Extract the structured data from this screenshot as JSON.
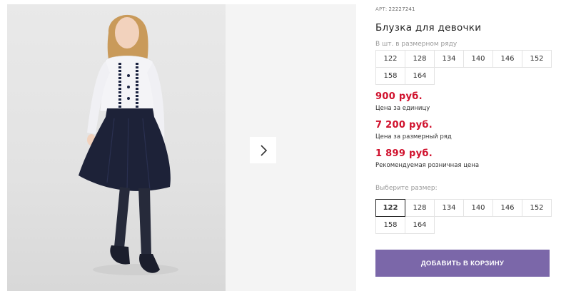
{
  "gallery": {
    "next_icon": "chevron-right-icon"
  },
  "product": {
    "art_label": "АРТ:",
    "art_value": "22227241",
    "title": "Блузка для девочки",
    "size_row_label": "В шт. в размерном ряду",
    "size_row": [
      "122",
      "128",
      "134",
      "140",
      "146",
      "152",
      "158",
      "164"
    ],
    "prices": [
      {
        "value": "900 руб.",
        "note": "Цена за единицу"
      },
      {
        "value": "7 200 руб.",
        "note": "Цена за размерный ряд"
      },
      {
        "value": "1 899 руб.",
        "note": "Рекомендуемая розничная цена"
      }
    ],
    "choose_label": "Выберите размер:",
    "sizes": [
      "122",
      "128",
      "134",
      "140",
      "146",
      "152",
      "158",
      "164"
    ],
    "selected_size": "122",
    "cart_button": "ДОБАВИТЬ В КОРЗИНУ",
    "colors": {
      "price": "#d0102c",
      "button": "#7b67a9"
    }
  }
}
